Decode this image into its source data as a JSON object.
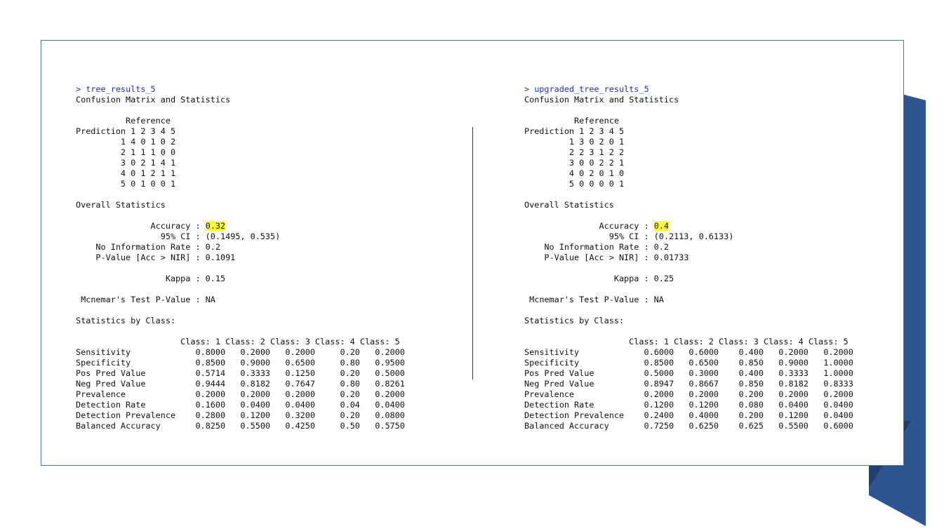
{
  "left": {
    "command": "> tree_results_5",
    "heading": "Confusion Matrix and Statistics",
    "reference_label": "Reference",
    "prediction_header": "Prediction 1 2 3 4 5",
    "matrix_rows": [
      "1 4 0 1 0 2",
      "2 1 1 1 0 0",
      "3 0 2 1 4 1",
      "4 0 1 2 1 1",
      "5 0 1 0 0 1"
    ],
    "overall_title": "Overall Statistics",
    "accuracy_label": "Accuracy : ",
    "accuracy_value": "0.32",
    "ci_line": "95% CI : (0.1495, 0.535)",
    "nir_line": "No Information Rate : 0.2",
    "pvalue_line": "P-Value [Acc > NIR] : 0.1091",
    "kappa_line": "Kappa : 0.15",
    "mcnemar_line": "Mcnemar's Test P-Value : NA",
    "by_class_title": "Statistics by Class:",
    "class_header": "Class: 1 Class: 2 Class: 3 Class: 4 Class: 5",
    "rows": [
      {
        "label": "Sensitivity",
        "values": [
          "0.8000",
          "0.2000",
          "0.2000",
          "0.20",
          "0.2000"
        ]
      },
      {
        "label": "Specificity",
        "values": [
          "0.8500",
          "0.9000",
          "0.6500",
          "0.80",
          "0.9500"
        ]
      },
      {
        "label": "Pos Pred Value",
        "values": [
          "0.5714",
          "0.3333",
          "0.1250",
          "0.20",
          "0.5000"
        ]
      },
      {
        "label": "Neg Pred Value",
        "values": [
          "0.9444",
          "0.8182",
          "0.7647",
          "0.80",
          "0.8261"
        ]
      },
      {
        "label": "Prevalence",
        "values": [
          "0.2000",
          "0.2000",
          "0.2000",
          "0.20",
          "0.2000"
        ]
      },
      {
        "label": "Detection Rate",
        "values": [
          "0.1600",
          "0.0400",
          "0.0400",
          "0.04",
          "0.0400"
        ]
      },
      {
        "label": "Detection Prevalence",
        "values": [
          "0.2800",
          "0.1200",
          "0.3200",
          "0.20",
          "0.0800"
        ]
      },
      {
        "label": "Balanced Accuracy",
        "values": [
          "0.8250",
          "0.5500",
          "0.4250",
          "0.50",
          "0.5750"
        ]
      }
    ]
  },
  "right": {
    "command": "> upgraded_tree_results_5",
    "heading": "Confusion Matrix and Statistics",
    "reference_label": "Reference",
    "prediction_header": "Prediction 1 2 3 4 5",
    "matrix_rows": [
      "1 3 0 2 0 1",
      "2 2 3 1 2 2",
      "3 0 0 2 2 1",
      "4 0 2 0 1 0",
      "5 0 0 0 0 1"
    ],
    "overall_title": "Overall Statistics",
    "accuracy_label": "Accuracy : ",
    "accuracy_value": "0.4",
    "ci_line": "95% CI : (0.2113, 0.6133)",
    "nir_line": "No Information Rate : 0.2",
    "pvalue_line": "P-Value [Acc > NIR] : 0.01733",
    "kappa_line": "Kappa : 0.25",
    "mcnemar_line": "Mcnemar's Test P-Value : NA",
    "by_class_title": "Statistics by Class:",
    "class_header": "Class: 1 Class: 2 Class: 3 Class: 4 Class: 5",
    "rows": [
      {
        "label": "Sensitivity",
        "values": [
          "0.6000",
          "0.6000",
          "0.400",
          "0.2000",
          "0.2000"
        ]
      },
      {
        "label": "Specificity",
        "values": [
          "0.8500",
          "0.6500",
          "0.850",
          "0.9000",
          "1.0000"
        ]
      },
      {
        "label": "Pos Pred Value",
        "values": [
          "0.5000",
          "0.3000",
          "0.400",
          "0.3333",
          "1.0000"
        ]
      },
      {
        "label": "Neg Pred Value",
        "values": [
          "0.8947",
          "0.8667",
          "0.850",
          "0.8182",
          "0.8333"
        ]
      },
      {
        "label": "Prevalence",
        "values": [
          "0.2000",
          "0.2000",
          "0.200",
          "0.2000",
          "0.2000"
        ]
      },
      {
        "label": "Detection Rate",
        "values": [
          "0.1200",
          "0.1200",
          "0.080",
          "0.0400",
          "0.0400"
        ]
      },
      {
        "label": "Detection Prevalence",
        "values": [
          "0.2400",
          "0.4000",
          "0.200",
          "0.1200",
          "0.0400"
        ]
      },
      {
        "label": "Balanced Accuracy",
        "values": [
          "0.7250",
          "0.6250",
          "0.625",
          "0.5500",
          "0.6000"
        ]
      }
    ]
  },
  "colors": {
    "highlight": "#ffff33",
    "frame_border": "#4d77b1",
    "command": "#1f2fc7",
    "accent_band": "#2e5591"
  }
}
